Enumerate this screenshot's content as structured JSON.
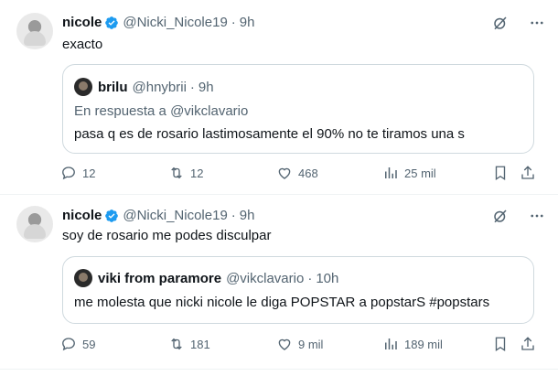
{
  "tweets": [
    {
      "author_name": "nicole",
      "author_handle": "@Nicki_Nicole19",
      "separator": "·",
      "time": "9h",
      "text": "exacto",
      "quote": {
        "author_name": "brilu",
        "author_handle": "@hnybrii",
        "separator": "·",
        "time": "9h",
        "replying_prefix": "En respuesta a",
        "replying_mention": "@vikclavario",
        "text": "pasa q es de rosario lastimosamente el 90% no te tiramos una s"
      },
      "actions": {
        "replies": "12",
        "reposts": "12",
        "likes": "468",
        "views": "25 mil"
      }
    },
    {
      "author_name": "nicole",
      "author_handle": "@Nicki_Nicole19",
      "separator": "·",
      "time": "9h",
      "text": "soy de rosario me podes disculpar",
      "quote": {
        "author_name": "viki from paramore",
        "author_handle": "@vikclavario",
        "separator": "·",
        "time": "10h",
        "text": "me molesta que nicki nicole le diga POPSTAR a popstarS #popstars"
      },
      "actions": {
        "replies": "59",
        "reposts": "181",
        "likes": "9 mil",
        "views": "189 mil"
      }
    }
  ],
  "icons": {
    "verified_color": "#1d9bf0",
    "muted_color": "#536471",
    "icon_names": [
      "grok-icon",
      "more-icon",
      "reply-icon",
      "repost-icon",
      "like-icon",
      "views-icon",
      "bookmark-icon",
      "share-icon"
    ]
  }
}
